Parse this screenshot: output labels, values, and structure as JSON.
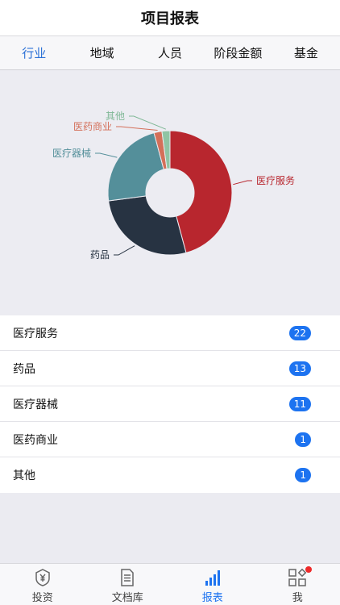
{
  "header": {
    "title": "项目报表"
  },
  "tabs": [
    {
      "label": "行业",
      "active": true
    },
    {
      "label": "地域",
      "active": false
    },
    {
      "label": "人员",
      "active": false
    },
    {
      "label": "阶段金额",
      "active": false
    },
    {
      "label": "基金",
      "active": false
    }
  ],
  "chart_data": {
    "type": "pie",
    "categories": [
      "医疗服务",
      "药品",
      "医疗器械",
      "医药商业",
      "其他"
    ],
    "values": [
      22,
      13,
      11,
      1,
      1
    ],
    "colors": [
      "#b8262e",
      "#273342",
      "#548f9a",
      "#d46f59",
      "#8fc4a4"
    ],
    "label_colors": [
      "#b8262e",
      "#273342",
      "#548f9a",
      "#d46f59",
      "#7fb896"
    ],
    "title": "",
    "donut": true
  },
  "list": [
    {
      "label": "医疗服务",
      "count": "22"
    },
    {
      "label": "药品",
      "count": "13"
    },
    {
      "label": "医疗器械",
      "count": "11"
    },
    {
      "label": "医药商业",
      "count": "1"
    },
    {
      "label": "其他",
      "count": "1"
    }
  ],
  "tabbar": [
    {
      "label": "投资",
      "icon": "yen-shield-icon",
      "active": false
    },
    {
      "label": "文档库",
      "icon": "document-icon",
      "active": false
    },
    {
      "label": "报表",
      "icon": "bar-chart-icon",
      "active": true
    },
    {
      "label": "我",
      "icon": "grid-apps-icon",
      "active": false,
      "notification_dot": true
    }
  ],
  "accent_color": "#1d73f0"
}
